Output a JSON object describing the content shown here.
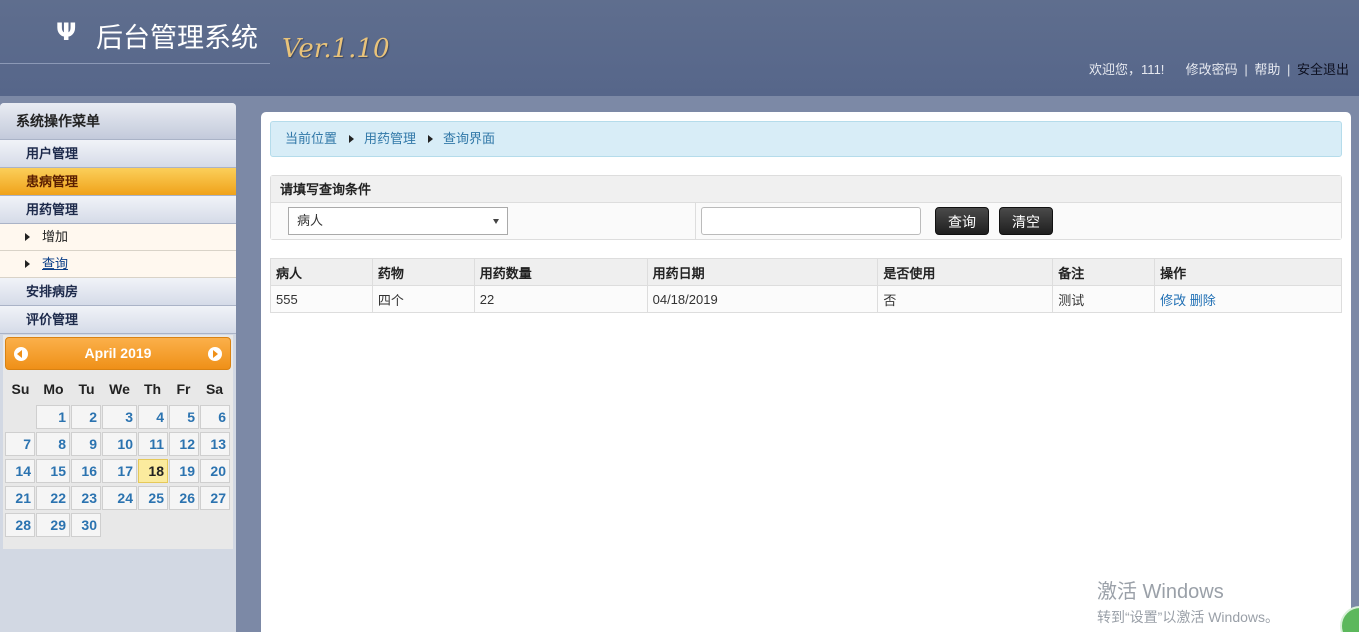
{
  "header": {
    "logo_icon": "Ψ",
    "title": "后台管理系统",
    "version": "Ver.1.10",
    "welcome": "欢迎您，111!",
    "change_password": "修改密码",
    "separator": "|",
    "help": "帮助",
    "logout": "安全退出"
  },
  "sidebar": {
    "heading": "系统操作菜单",
    "items": [
      {
        "label": "用户管理"
      },
      {
        "label": "患病管理"
      },
      {
        "label": "用药管理"
      },
      {
        "label": "安排病房"
      },
      {
        "label": "评价管理"
      }
    ],
    "subitems": [
      {
        "label": "增加"
      },
      {
        "label": "查询"
      }
    ]
  },
  "calendar": {
    "title": "April 2019",
    "weekdays": [
      "Su",
      "Mo",
      "Tu",
      "We",
      "Th",
      "Fr",
      "Sa"
    ],
    "days": [
      "1",
      "2",
      "3",
      "4",
      "5",
      "6",
      "7",
      "8",
      "9",
      "10",
      "11",
      "12",
      "13",
      "14",
      "15",
      "16",
      "17",
      "18",
      "19",
      "20",
      "21",
      "22",
      "23",
      "24",
      "25",
      "26",
      "27",
      "28",
      "29",
      "30"
    ],
    "today": "18",
    "accent_color": "#ef9018"
  },
  "breadcrumb": {
    "items": [
      "当前位置",
      "用药管理",
      "查询界面"
    ]
  },
  "query": {
    "title": "请填写查询条件",
    "select_value": "病人",
    "input_value": "",
    "search_label": "查询",
    "clear_label": "清空"
  },
  "table": {
    "headers": [
      "病人",
      "药物",
      "用药数量",
      "用药日期",
      "是否使用",
      "备注",
      "操作"
    ],
    "rows": [
      {
        "patient": "555",
        "drug": "四个",
        "quantity": "22",
        "date": "04/18/2019",
        "used": "否",
        "remark": "测试",
        "edit": "修改",
        "delete": "删除"
      }
    ]
  },
  "watermark": {
    "line1": "激活 Windows",
    "line2": "转到“设置”以激活 Windows。"
  }
}
